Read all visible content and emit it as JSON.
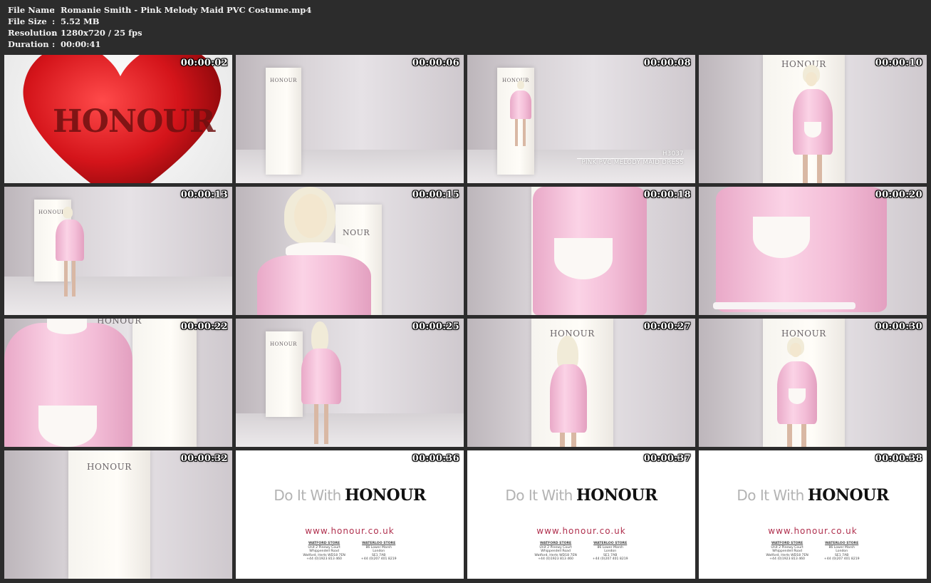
{
  "file_info": [
    {
      "label": "File Name",
      "value": "Romanie Smith - Pink Melody Maid PVC Costume.mp4"
    },
    {
      "label": "File Size",
      "value": "5.52 MB"
    },
    {
      "label": "Resolution",
      "value": "1280x720 / 25 fps"
    },
    {
      "label": "Duration",
      "value": "00:00:41"
    }
  ],
  "separator": ":",
  "thumbnails": [
    {
      "time": "00:00:02",
      "scene": "heart",
      "logo": "HONOUR"
    },
    {
      "time": "00:00:06",
      "scene": "empty-studio",
      "logo": "HONOUR"
    },
    {
      "time": "00:00:08",
      "scene": "model-far",
      "logo": "HONOUR",
      "caption_code": "H3037",
      "caption_text": "PINK PVC MELODY MAID DRESS"
    },
    {
      "time": "00:00:10",
      "scene": "model-mid",
      "logo": "HONOUR"
    },
    {
      "time": "00:00:13",
      "scene": "model-walking",
      "logo": "HONOUR"
    },
    {
      "time": "00:00:15",
      "scene": "closeup-face",
      "logo": "NOUR"
    },
    {
      "time": "00:00:18",
      "scene": "closeup-apron"
    },
    {
      "time": "00:00:20",
      "scene": "closeup-skirt"
    },
    {
      "time": "00:00:22",
      "scene": "closeup-torso",
      "logo": "HONOUR"
    },
    {
      "time": "00:00:25",
      "scene": "back-view",
      "logo": "HONOUR"
    },
    {
      "time": "00:00:27",
      "scene": "side-view",
      "logo": "HONOUR"
    },
    {
      "time": "00:00:30",
      "scene": "model-mid",
      "logo": "HONOUR"
    },
    {
      "time": "00:00:32",
      "scene": "empty-panel",
      "logo": "HONOUR"
    },
    {
      "time": "00:00:36",
      "scene": "promo"
    },
    {
      "time": "00:00:37",
      "scene": "promo"
    },
    {
      "time": "00:00:38",
      "scene": "promo"
    }
  ],
  "promo": {
    "tagline_light": "Do It With",
    "tagline_brand": "HONOUR",
    "url": "www.honour.co.uk",
    "stores": [
      {
        "title": "WATFORD STORE",
        "lines": [
          "Unit 2 Pinewy Court",
          "Whippendell Road",
          "Watford, Herts WD18 7EN",
          "+44 (0)1923 813 460"
        ]
      },
      {
        "title": "WATERLOO STORE",
        "lines": [
          "86 Lower Marsh",
          "London",
          "SE1 7AB",
          "+44 (0)207 401 8219"
        ]
      }
    ]
  },
  "colors": {
    "background": "#2c2c2c",
    "info_text": "#f2f2f2",
    "heart": "#d4141a",
    "dress": "#f7c3dc",
    "url": "#b0304e"
  }
}
